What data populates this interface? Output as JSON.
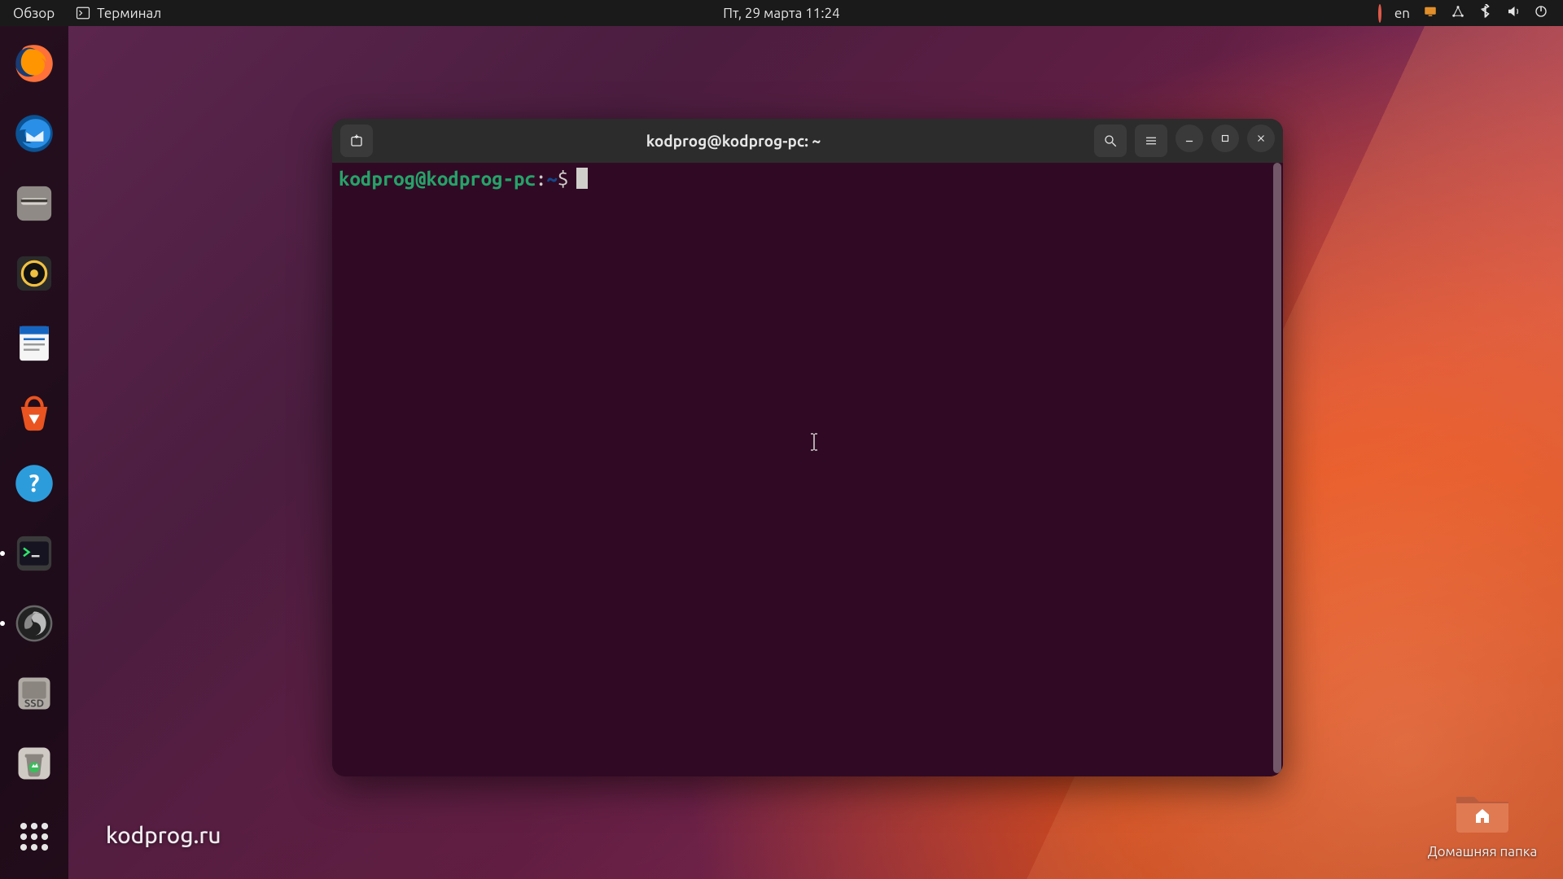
{
  "topbar": {
    "activities": "Обзор",
    "app_name": "Терминал",
    "clock": "Пт, 29 марта  11:24",
    "lang": "en"
  },
  "dock": {
    "items": [
      {
        "name": "firefox"
      },
      {
        "name": "thunderbird"
      },
      {
        "name": "files"
      },
      {
        "name": "rhythmbox"
      },
      {
        "name": "writer"
      },
      {
        "name": "software"
      },
      {
        "name": "help"
      },
      {
        "name": "terminal"
      },
      {
        "name": "obs"
      },
      {
        "name": "disk-ssd",
        "label": "SSD"
      },
      {
        "name": "trash"
      }
    ]
  },
  "terminal": {
    "title": "kodprog@kodprog-pc: ~",
    "prompt_user_host": "kodprog@kodprog-pc",
    "prompt_colon": ":",
    "prompt_path": "~",
    "prompt_dollar": "$"
  },
  "desktop": {
    "home_label": "Домашняя папка"
  },
  "watermark": "kodprog.ru"
}
